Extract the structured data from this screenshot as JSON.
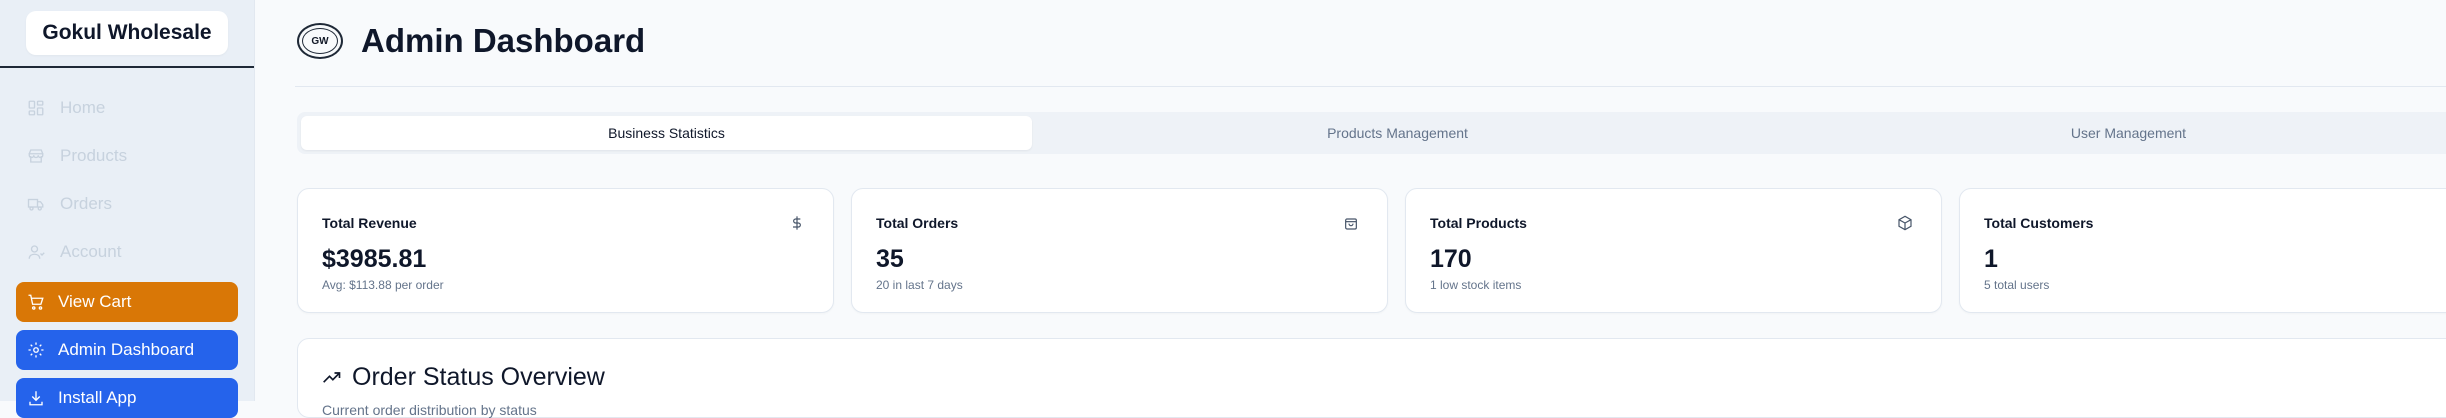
{
  "brand": {
    "name": "Gokul Wholesale",
    "logo_text": "GW"
  },
  "nav": {
    "items": [
      {
        "label": "Home",
        "icon": "layout-grid-icon"
      },
      {
        "label": "Products",
        "icon": "store-icon"
      },
      {
        "label": "Orders",
        "icon": "truck-icon"
      },
      {
        "label": "Account",
        "icon": "user-icon"
      }
    ],
    "buttons": [
      {
        "label": "View Cart",
        "icon": "cart-icon",
        "color": "#d97706"
      },
      {
        "label": "Admin Dashboard",
        "icon": "gear-icon",
        "color": "#2563eb"
      },
      {
        "label": "Install App",
        "icon": "download-icon",
        "color": "#2563eb"
      }
    ]
  },
  "header": {
    "title": "Admin Dashboard"
  },
  "tabs": [
    {
      "label": "Business Statistics",
      "active": true
    },
    {
      "label": "Products Management",
      "active": false
    },
    {
      "label": "User Management",
      "active": false
    }
  ],
  "cards": [
    {
      "label": "Total Revenue",
      "value": "$3985.81",
      "sub": "Avg: $113.88 per order",
      "icon": "dollar-icon"
    },
    {
      "label": "Total Orders",
      "value": "35",
      "sub": "20 in last 7 days",
      "icon": "shopping-bag-icon"
    },
    {
      "label": "Total Products",
      "value": "170",
      "sub": "1 low stock items",
      "icon": "package-icon"
    },
    {
      "label": "Total Customers",
      "value": "1",
      "sub": "5 total users",
      "icon": "users-icon"
    }
  ],
  "section": {
    "title": "Order Status Overview",
    "subtitle": "Current order distribution by status",
    "icon": "trending-up-icon"
  },
  "colors": {
    "accent": "#2563eb",
    "cart": "#d97706",
    "sidebar_bg": "#e9eff6"
  }
}
